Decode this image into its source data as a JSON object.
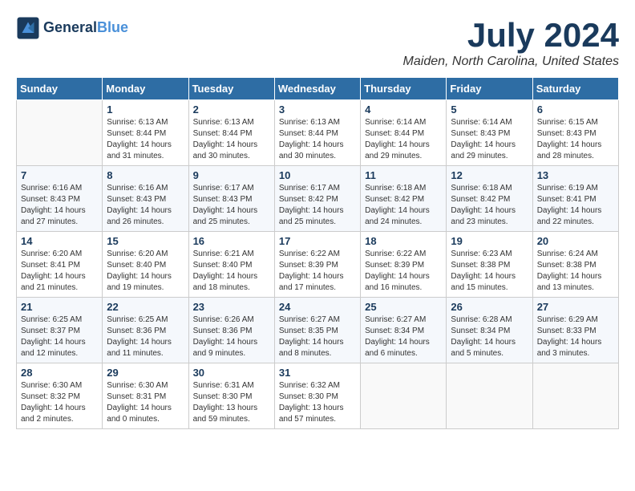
{
  "header": {
    "logo_line1": "General",
    "logo_line2": "Blue",
    "main_title": "July 2024",
    "subtitle": "Maiden, North Carolina, United States"
  },
  "columns": [
    "Sunday",
    "Monday",
    "Tuesday",
    "Wednesday",
    "Thursday",
    "Friday",
    "Saturday"
  ],
  "weeks": [
    [
      {
        "day": "",
        "info": ""
      },
      {
        "day": "1",
        "info": "Sunrise: 6:13 AM\nSunset: 8:44 PM\nDaylight: 14 hours and 31 minutes."
      },
      {
        "day": "2",
        "info": "Sunrise: 6:13 AM\nSunset: 8:44 PM\nDaylight: 14 hours and 30 minutes."
      },
      {
        "day": "3",
        "info": "Sunrise: 6:13 AM\nSunset: 8:44 PM\nDaylight: 14 hours and 30 minutes."
      },
      {
        "day": "4",
        "info": "Sunrise: 6:14 AM\nSunset: 8:44 PM\nDaylight: 14 hours and 29 minutes."
      },
      {
        "day": "5",
        "info": "Sunrise: 6:14 AM\nSunset: 8:43 PM\nDaylight: 14 hours and 29 minutes."
      },
      {
        "day": "6",
        "info": "Sunrise: 6:15 AM\nSunset: 8:43 PM\nDaylight: 14 hours and 28 minutes."
      }
    ],
    [
      {
        "day": "7",
        "info": "Sunrise: 6:16 AM\nSunset: 8:43 PM\nDaylight: 14 hours and 27 minutes."
      },
      {
        "day": "8",
        "info": "Sunrise: 6:16 AM\nSunset: 8:43 PM\nDaylight: 14 hours and 26 minutes."
      },
      {
        "day": "9",
        "info": "Sunrise: 6:17 AM\nSunset: 8:43 PM\nDaylight: 14 hours and 25 minutes."
      },
      {
        "day": "10",
        "info": "Sunrise: 6:17 AM\nSunset: 8:42 PM\nDaylight: 14 hours and 25 minutes."
      },
      {
        "day": "11",
        "info": "Sunrise: 6:18 AM\nSunset: 8:42 PM\nDaylight: 14 hours and 24 minutes."
      },
      {
        "day": "12",
        "info": "Sunrise: 6:18 AM\nSunset: 8:42 PM\nDaylight: 14 hours and 23 minutes."
      },
      {
        "day": "13",
        "info": "Sunrise: 6:19 AM\nSunset: 8:41 PM\nDaylight: 14 hours and 22 minutes."
      }
    ],
    [
      {
        "day": "14",
        "info": "Sunrise: 6:20 AM\nSunset: 8:41 PM\nDaylight: 14 hours and 21 minutes."
      },
      {
        "day": "15",
        "info": "Sunrise: 6:20 AM\nSunset: 8:40 PM\nDaylight: 14 hours and 19 minutes."
      },
      {
        "day": "16",
        "info": "Sunrise: 6:21 AM\nSunset: 8:40 PM\nDaylight: 14 hours and 18 minutes."
      },
      {
        "day": "17",
        "info": "Sunrise: 6:22 AM\nSunset: 8:39 PM\nDaylight: 14 hours and 17 minutes."
      },
      {
        "day": "18",
        "info": "Sunrise: 6:22 AM\nSunset: 8:39 PM\nDaylight: 14 hours and 16 minutes."
      },
      {
        "day": "19",
        "info": "Sunrise: 6:23 AM\nSunset: 8:38 PM\nDaylight: 14 hours and 15 minutes."
      },
      {
        "day": "20",
        "info": "Sunrise: 6:24 AM\nSunset: 8:38 PM\nDaylight: 14 hours and 13 minutes."
      }
    ],
    [
      {
        "day": "21",
        "info": "Sunrise: 6:25 AM\nSunset: 8:37 PM\nDaylight: 14 hours and 12 minutes."
      },
      {
        "day": "22",
        "info": "Sunrise: 6:25 AM\nSunset: 8:36 PM\nDaylight: 14 hours and 11 minutes."
      },
      {
        "day": "23",
        "info": "Sunrise: 6:26 AM\nSunset: 8:36 PM\nDaylight: 14 hours and 9 minutes."
      },
      {
        "day": "24",
        "info": "Sunrise: 6:27 AM\nSunset: 8:35 PM\nDaylight: 14 hours and 8 minutes."
      },
      {
        "day": "25",
        "info": "Sunrise: 6:27 AM\nSunset: 8:34 PM\nDaylight: 14 hours and 6 minutes."
      },
      {
        "day": "26",
        "info": "Sunrise: 6:28 AM\nSunset: 8:34 PM\nDaylight: 14 hours and 5 minutes."
      },
      {
        "day": "27",
        "info": "Sunrise: 6:29 AM\nSunset: 8:33 PM\nDaylight: 14 hours and 3 minutes."
      }
    ],
    [
      {
        "day": "28",
        "info": "Sunrise: 6:30 AM\nSunset: 8:32 PM\nDaylight: 14 hours and 2 minutes."
      },
      {
        "day": "29",
        "info": "Sunrise: 6:30 AM\nSunset: 8:31 PM\nDaylight: 14 hours and 0 minutes."
      },
      {
        "day": "30",
        "info": "Sunrise: 6:31 AM\nSunset: 8:30 PM\nDaylight: 13 hours and 59 minutes."
      },
      {
        "day": "31",
        "info": "Sunrise: 6:32 AM\nSunset: 8:30 PM\nDaylight: 13 hours and 57 minutes."
      },
      {
        "day": "",
        "info": ""
      },
      {
        "day": "",
        "info": ""
      },
      {
        "day": "",
        "info": ""
      }
    ]
  ]
}
